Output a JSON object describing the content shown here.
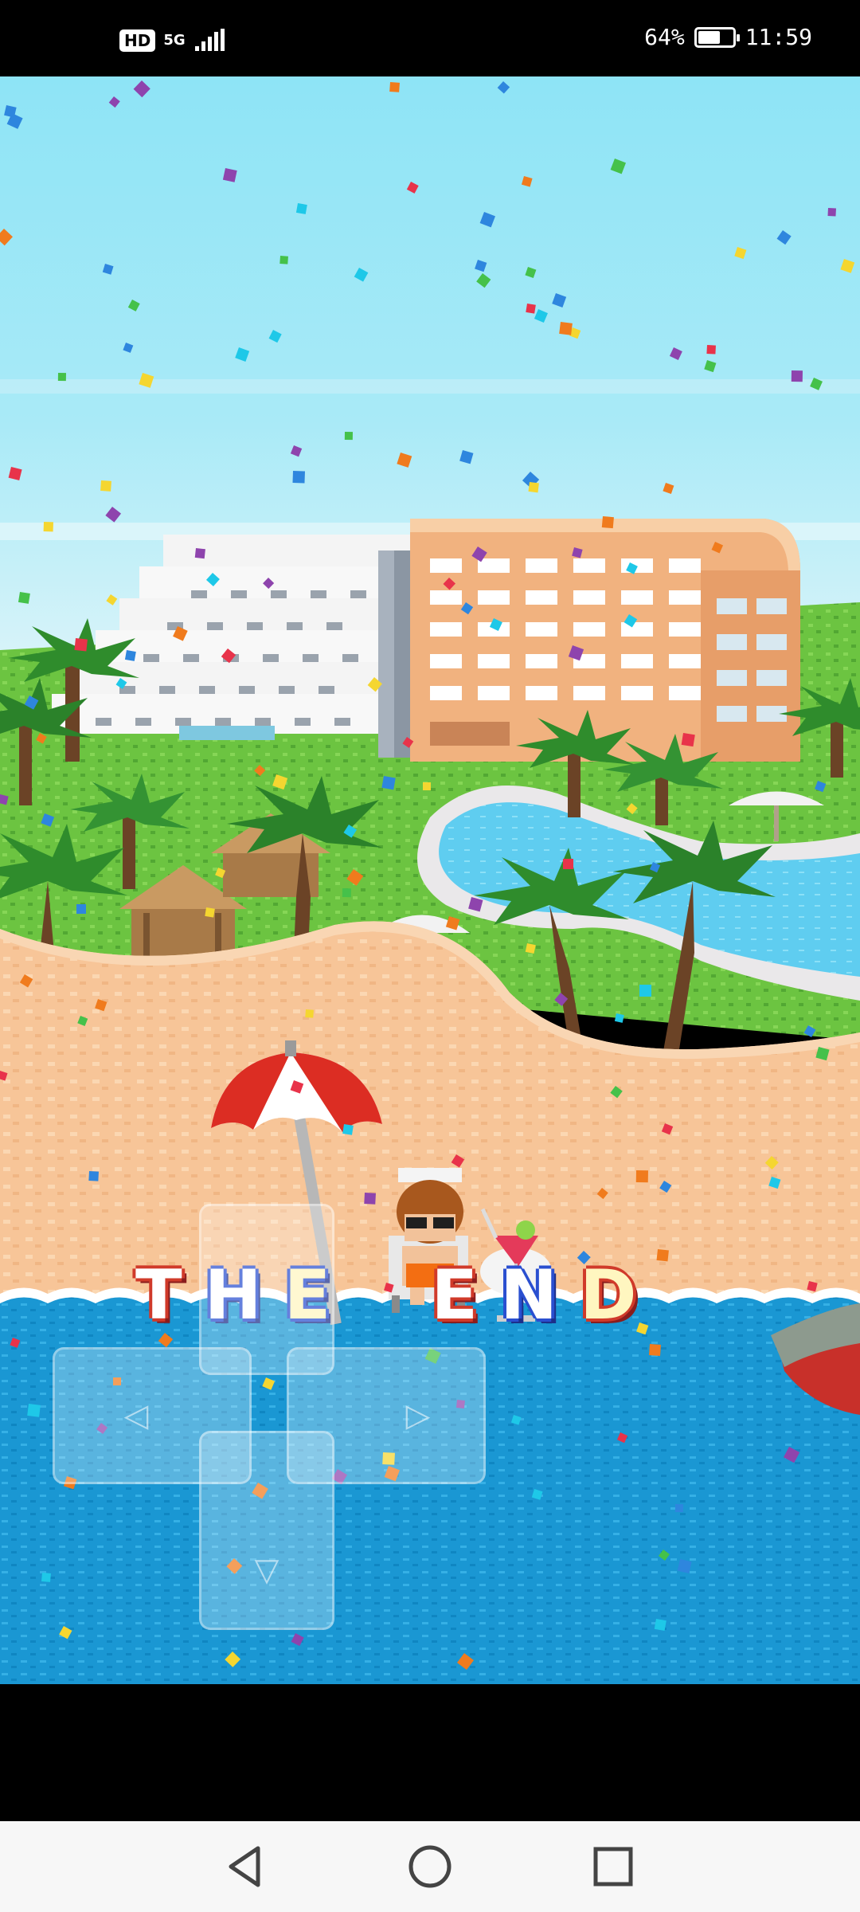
{
  "status_bar": {
    "hd_label": "HD",
    "network_label": "5G",
    "battery_percent_text": "64%",
    "battery_level": 0.64,
    "time": "11:59",
    "icons": [
      "hd-icon",
      "signal-icon",
      "battery-icon"
    ]
  },
  "game": {
    "ending_letters": [
      "T",
      "H",
      "E",
      "E",
      "N",
      "D"
    ],
    "dpad": {
      "left_symbol": "◁",
      "right_symbol": "▷",
      "down_symbol": "▽"
    }
  },
  "colors": {
    "sky_top": "#8fe3f5",
    "sky_bottom": "#cdf0f8",
    "grass": "#6ec843",
    "sand": "#f8c89a",
    "sea": "#1a9bd6",
    "hotel_orange": "#f0b080",
    "pool": "#6fd3f0"
  },
  "nav_bar": {
    "icons": [
      "back-icon",
      "home-icon",
      "recents-icon"
    ]
  }
}
